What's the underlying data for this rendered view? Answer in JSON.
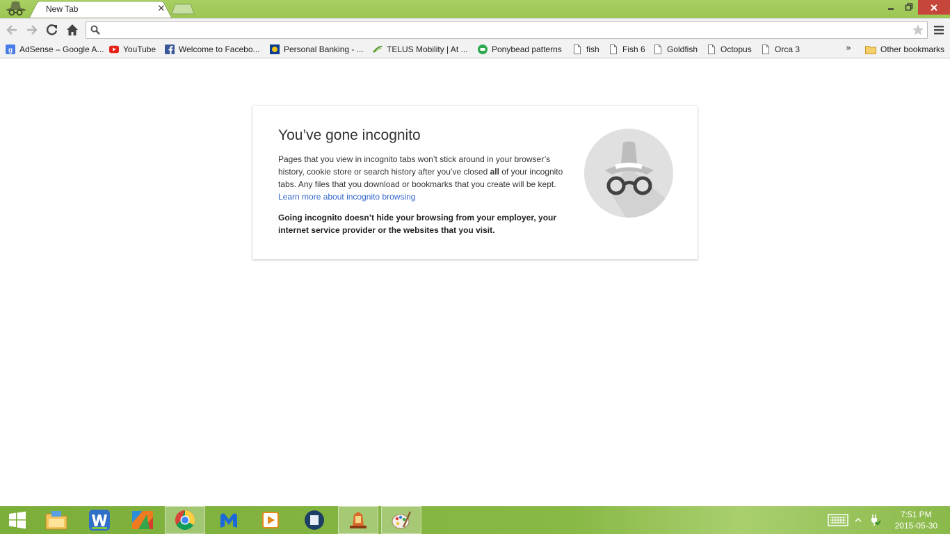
{
  "browser": {
    "tab_title": "New Tab",
    "tab_close": "×",
    "omnibox_value": "",
    "omnibox_placeholder": ""
  },
  "window_controls": {
    "minimize": "–",
    "restore": "❐",
    "close": "✕"
  },
  "bookmarks": [
    {
      "label": "AdSense – Google A...",
      "icon": "adsense-icon"
    },
    {
      "label": "YouTube",
      "icon": "youtube-icon"
    },
    {
      "label": "Welcome to Facebo...",
      "icon": "facebook-icon"
    },
    {
      "label": "Personal Banking - ...",
      "icon": "bank-icon"
    },
    {
      "label": "TELUS Mobility | At ...",
      "icon": "telus-icon"
    },
    {
      "label": "Ponybead patterns",
      "icon": "ponybead-icon"
    },
    {
      "label": "fish",
      "icon": "page-icon"
    },
    {
      "label": "Fish 6",
      "icon": "page-icon"
    },
    {
      "label": "Goldfish",
      "icon": "page-icon"
    },
    {
      "label": "Octopus",
      "icon": "page-icon"
    },
    {
      "label": "Orca 3",
      "icon": "page-icon"
    }
  ],
  "bookmarks_more": "»",
  "other_bookmarks": "Other bookmarks",
  "incognito": {
    "title": "You’ve gone incognito",
    "body_1": "Pages that you view in incognito tabs won’t stick around in your browser’s history, cookie store or search history after you’ve closed ",
    "body_bold": "all",
    "body_2": " of your incognito tabs. Any files that you download or bookmarks that you create will be kept.",
    "learn_more": "Learn more about incognito browsing",
    "warning": "Going incognito doesn’t hide your browsing from your employer, your internet service provider or the websites that you visit."
  },
  "taskbar": {
    "time": "7:51 PM",
    "date": "2015-05-30",
    "apps": [
      "start-icon",
      "file-explorer-icon",
      "wps-writer-icon",
      "photo-app-icon",
      "chrome-icon",
      "malwarebytes-icon",
      "media-player-icon",
      "video-app-icon",
      "solitaire-icon",
      "paint-icon"
    ]
  },
  "colors": {
    "frame": "#9cc653",
    "taskbar": "#82b240",
    "link": "#3366cc",
    "close": "#c7463c"
  }
}
